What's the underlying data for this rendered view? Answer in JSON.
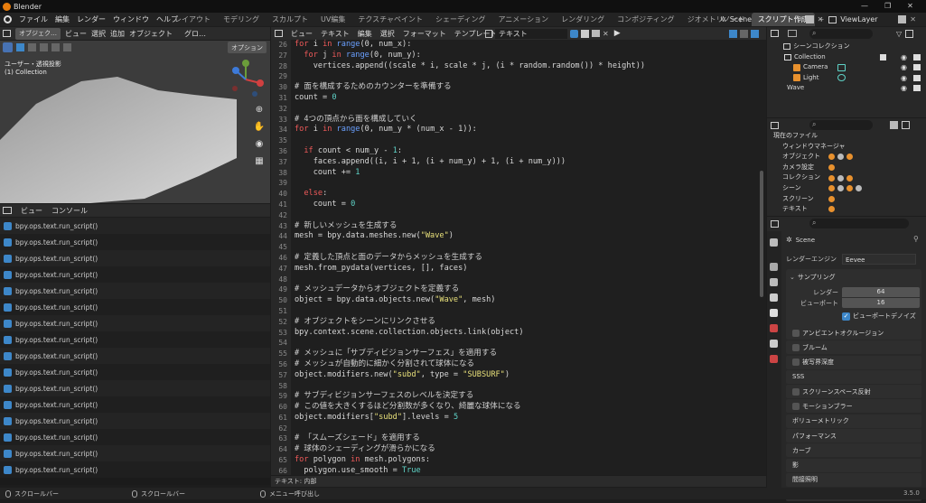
{
  "app": {
    "title": "Blender"
  },
  "menu": [
    "ファイル",
    "編集",
    "レンダー",
    "ウィンドウ",
    "ヘルプ"
  ],
  "workspaces": [
    "レイアウト",
    "モデリング",
    "スカルプト",
    "UV編集",
    "テクスチャペイント",
    "シェーディング",
    "アニメーション",
    "レンダリング",
    "コンポジティング",
    "ジオメトリノード",
    "スクリプト作成"
  ],
  "scene": "Scene",
  "view_layer": "ViewLayer",
  "viewport": {
    "mode": "オブジェク…",
    "menus": [
      "ビュー",
      "選択",
      "追加",
      "オブジェクト"
    ],
    "orientation": "グロ…",
    "options": "オプション",
    "view_name": "ユーザー・透視投影",
    "collection": "(1) Collection"
  },
  "console": {
    "menus": [
      "ビュー",
      "コンソール"
    ],
    "command": "bpy.ops.text.run_script()",
    "rows": 16
  },
  "editor": {
    "menus": [
      "ビュー",
      "テキスト",
      "編集",
      "選択",
      "フォーマット",
      "テンプレート"
    ],
    "text_name": "テキスト",
    "footer": "テキスト: 内部",
    "lines": [
      {
        "n": "26",
        "s": [
          [
            "kw",
            "for "
          ],
          [
            "",
            "i "
          ],
          [
            "kw",
            "in "
          ],
          [
            "fn",
            "range"
          ],
          [
            "",
            "(0, num_x):"
          ]
        ]
      },
      {
        "n": "27",
        "s": [
          [
            "",
            "  "
          ],
          [
            "kw",
            "for "
          ],
          [
            "",
            "j "
          ],
          [
            "kw",
            "in "
          ],
          [
            "fn",
            "range"
          ],
          [
            "",
            "(0, num_y):"
          ]
        ]
      },
      {
        "n": "28",
        "s": [
          [
            "",
            "    vertices.append((scale * i, scale * j, (i * random.random()) * height))"
          ]
        ]
      },
      {
        "n": "29",
        "s": []
      },
      {
        "n": "30",
        "s": [
          [
            "cm",
            "# 面を構成するためのカウンターを準備する"
          ]
        ]
      },
      {
        "n": "31",
        "s": [
          [
            "",
            "count = "
          ],
          [
            "num",
            "0"
          ]
        ]
      },
      {
        "n": "32",
        "s": []
      },
      {
        "n": "33",
        "s": [
          [
            "cm",
            "# 4つの頂点から面を構成していく"
          ]
        ]
      },
      {
        "n": "34",
        "s": [
          [
            "kw",
            "for "
          ],
          [
            "",
            "i "
          ],
          [
            "kw",
            "in "
          ],
          [
            "fn",
            "range"
          ],
          [
            "",
            "(0, num_y * (num_x - 1)):"
          ]
        ]
      },
      {
        "n": "35",
        "s": []
      },
      {
        "n": "36",
        "s": [
          [
            "",
            "  "
          ],
          [
            "kw",
            "if "
          ],
          [
            "",
            "count < num_y - "
          ],
          [
            "num",
            "1"
          ],
          [
            "",
            ":"
          ]
        ]
      },
      {
        "n": "37",
        "s": [
          [
            "",
            "    faces.append((i, i + 1, (i + num_y) + 1, (i + num_y)))"
          ]
        ]
      },
      {
        "n": "38",
        "s": [
          [
            "",
            "    count += "
          ],
          [
            "num",
            "1"
          ]
        ]
      },
      {
        "n": "39",
        "s": []
      },
      {
        "n": "40",
        "s": [
          [
            "",
            "  "
          ],
          [
            "kw",
            "else"
          ],
          [
            "",
            ":"
          ]
        ]
      },
      {
        "n": "41",
        "s": [
          [
            "",
            "    count = "
          ],
          [
            "num",
            "0"
          ]
        ]
      },
      {
        "n": "42",
        "s": []
      },
      {
        "n": "43",
        "s": [
          [
            "cm",
            "# 新しいメッシュを生成する"
          ]
        ]
      },
      {
        "n": "44",
        "s": [
          [
            "",
            "mesh = bpy.data.meshes.new("
          ],
          [
            "str",
            "\"Wave\""
          ],
          [
            "",
            ")"
          ]
        ]
      },
      {
        "n": "45",
        "s": []
      },
      {
        "n": "46",
        "s": [
          [
            "cm",
            "# 定義した頂点と面のデータからメッシュを生成する"
          ]
        ]
      },
      {
        "n": "47",
        "s": [
          [
            "",
            "mesh.from_pydata(vertices, [], faces)"
          ]
        ]
      },
      {
        "n": "48",
        "s": []
      },
      {
        "n": "49",
        "s": [
          [
            "cm",
            "# メッシュデータからオブジェクトを定義する"
          ]
        ]
      },
      {
        "n": "50",
        "s": [
          [
            "",
            "object = bpy.data.objects.new("
          ],
          [
            "str",
            "\"Wave\""
          ],
          [
            "",
            ", mesh)"
          ]
        ]
      },
      {
        "n": "51",
        "s": []
      },
      {
        "n": "52",
        "s": [
          [
            "cm",
            "# オブジェクトをシーンにリンクさせる"
          ]
        ]
      },
      {
        "n": "53",
        "s": [
          [
            "",
            "bpy.context.scene.collection.objects.link(object)"
          ]
        ]
      },
      {
        "n": "54",
        "s": []
      },
      {
        "n": "55",
        "s": [
          [
            "cm",
            "# メッシュに「サブディビジョンサーフェス」を適用する"
          ]
        ]
      },
      {
        "n": "56",
        "s": [
          [
            "cm",
            "# メッシュが自動的に細かく分割されて球体になる"
          ]
        ]
      },
      {
        "n": "57",
        "s": [
          [
            "",
            "object.modifiers.new("
          ],
          [
            "str",
            "\"subd\""
          ],
          [
            "",
            ", type = "
          ],
          [
            "str",
            "\"SUBSURF\""
          ],
          [
            "",
            ")"
          ]
        ]
      },
      {
        "n": "58",
        "s": []
      },
      {
        "n": "59",
        "s": [
          [
            "cm",
            "# サブディビジョンサーフェスのレベルを決定する"
          ]
        ]
      },
      {
        "n": "60",
        "s": [
          [
            "cm",
            "# この値を大きくするほど分割数が多くなり、綺麗な球体になる"
          ]
        ]
      },
      {
        "n": "61",
        "s": [
          [
            "",
            "object.modifiers["
          ],
          [
            "str",
            "\"subd\""
          ],
          [
            "",
            "].levels = "
          ],
          [
            "num",
            "5"
          ]
        ]
      },
      {
        "n": "62",
        "s": []
      },
      {
        "n": "63",
        "s": [
          [
            "cm",
            "# 「スムーズシェード」を適用する"
          ]
        ]
      },
      {
        "n": "64",
        "s": [
          [
            "cm",
            "# 球体のシェーディングが滑らかになる"
          ]
        ]
      },
      {
        "n": "65",
        "s": [
          [
            "kw",
            "for "
          ],
          [
            "",
            "polygon "
          ],
          [
            "kw",
            "in "
          ],
          [
            "",
            "mesh.polygons:"
          ]
        ]
      },
      {
        "n": "66",
        "s": [
          [
            "",
            "  polygon.use_smooth = "
          ],
          [
            "num",
            "True"
          ]
        ]
      }
    ]
  },
  "outliner": {
    "root": "シーンコレクション",
    "collection": "Collection",
    "items": [
      "Camera",
      "Light"
    ],
    "wave": "Wave"
  },
  "blendfile": {
    "root": "現在のファイル",
    "items": [
      "ウィンドウマネージャ",
      "オブジェクト",
      "カメラ設定",
      "コレクション",
      "シーン",
      "スクリーン",
      "テキスト"
    ]
  },
  "properties": {
    "scene": "Scene",
    "engine_label": "レンダーエンジン",
    "engine": "Eevee",
    "sampling": "サンプリング",
    "render_label": "レンダー",
    "render_val": "64",
    "viewport_label": "ビューポート",
    "viewport_val": "16",
    "denoise": "ビューポートデノイズ",
    "panels": [
      "アンビエントオクルージョン",
      "ブルーム",
      "被写界深度",
      "SSS",
      "スクリーンスペース反射",
      "モーションブラー",
      "ボリューメトリック",
      "パフォーマンス",
      "カーブ",
      "影",
      "間接照明",
      "フィルム"
    ]
  },
  "statusbar": {
    "a": "スクロールバー",
    "b": "スクロールバー",
    "c": "メニュー呼び出し",
    "version": "3.5.0"
  },
  "colors": {
    "kw": "#f05a5a",
    "fn": "#6aa0ff",
    "num": "#5fd3c7",
    "str": "#e8e07a",
    "cm": "#cfcfcf",
    "accent": "#3d87c9",
    "active_tab": "#4a4a4a"
  }
}
